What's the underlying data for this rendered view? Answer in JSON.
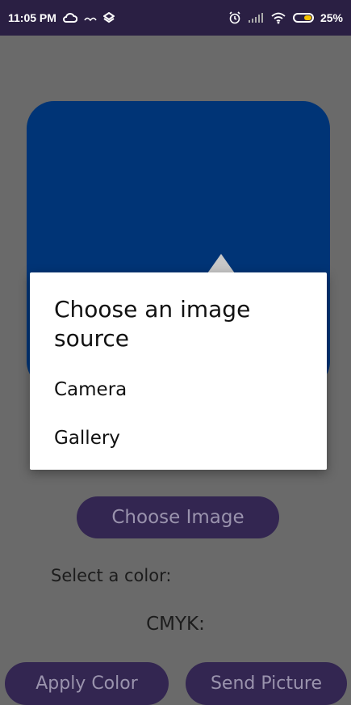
{
  "status_bar": {
    "time": "11:05 PM",
    "battery_percent": "25%",
    "icons": [
      "cloud-icon",
      "signal-hotspot-icon",
      "dropbox-icon",
      "alarm-icon",
      "cellular-signal-icon",
      "wifi-icon",
      "battery-icon"
    ]
  },
  "main": {
    "choose_image_label": "Choose Image",
    "select_color_label": "Select a color:",
    "cmyk_label": "CMYK:",
    "apply_color_label": "Apply Color",
    "send_picture_label": "Send Picture",
    "preview_color": "#003476"
  },
  "dialog": {
    "title": "Choose an image source",
    "items": [
      {
        "label": "Camera"
      },
      {
        "label": "Gallery"
      }
    ]
  },
  "colors": {
    "status_bar": "#2a1f43",
    "button": "#332651",
    "button_text": "#9a93ad",
    "dim_overlay": "#6a6a6a"
  }
}
